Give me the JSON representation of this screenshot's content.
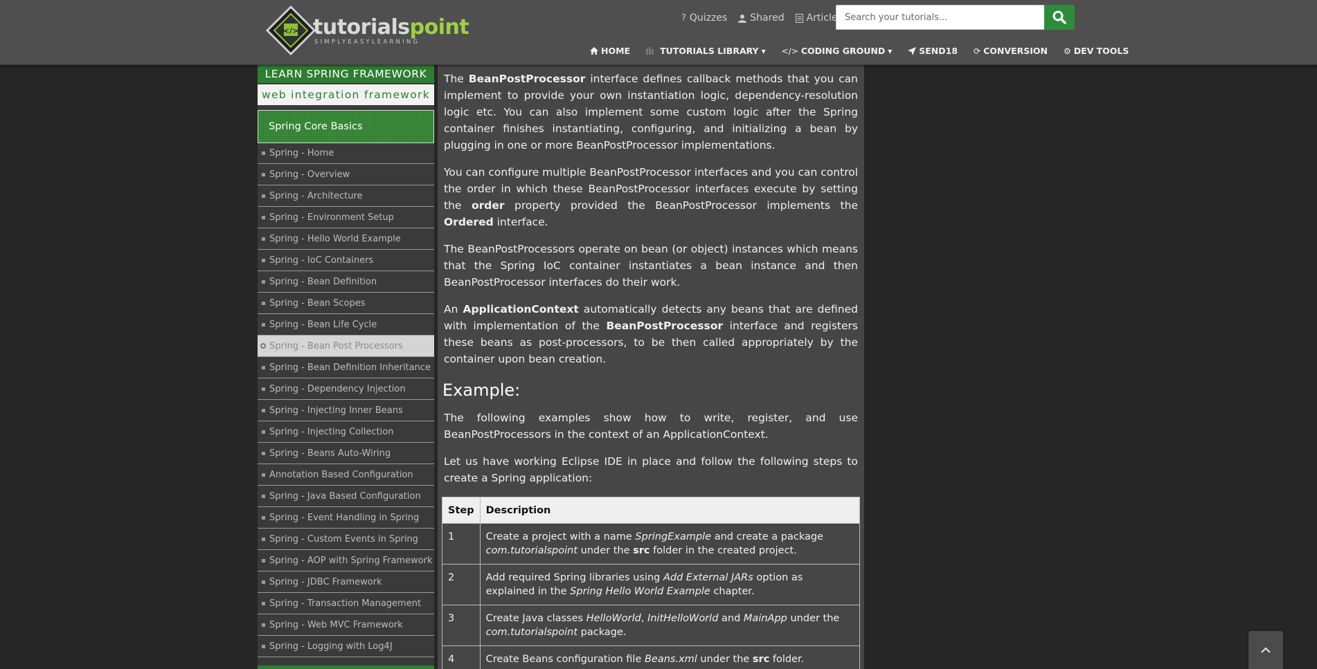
{
  "header": {
    "logo": {
      "brand_main": "tutorials",
      "brand_accent": "point",
      "tagline": "SIMPLYEASYLEARNING"
    },
    "top_links": [
      {
        "label": "Quizzes",
        "icon": "question-icon"
      },
      {
        "label": "Shared",
        "icon": "user-icon"
      },
      {
        "label": "Articles",
        "icon": "document-icon"
      }
    ],
    "search": {
      "placeholder": "Search your tutorials...",
      "icon": "search-icon"
    },
    "nav": [
      {
        "label": "HOME",
        "icon": "home-icon"
      },
      {
        "label": "TUTORIALS LIBRARY",
        "icon": "library-icon"
      },
      {
        "label": "CODING GROUND",
        "icon": "code-icon"
      },
      {
        "label": "SEND18",
        "icon": "send-icon"
      },
      {
        "label": "CONVERSION",
        "icon": "refresh-icon"
      },
      {
        "label": "DEV TOOLS",
        "icon": "gear-icon"
      }
    ]
  },
  "sidebar": {
    "banner": {
      "line1": "LEARN SPRING FRAMEWORK",
      "line2": "web integration framework"
    },
    "section_title": "Spring Core Basics",
    "items": [
      "Spring - Home",
      "Spring - Overview",
      "Spring - Architecture",
      "Spring - Environment Setup",
      "Spring - Hello World Example",
      "Spring - IoC Containers",
      "Spring - Bean Definition",
      "Spring - Bean Scopes",
      "Spring - Bean Life Cycle",
      "Spring - Bean Post Processors",
      "Spring - Bean Definition Inheritance",
      "Spring - Dependency Injection",
      "Spring - Injecting Inner Beans",
      "Spring - Injecting Collection",
      "Spring - Beans Auto-Wiring",
      "Annotation Based Configuration",
      "Spring - Java Based Configuration",
      "Spring - Event Handling in Spring",
      "Spring - Custom Events in Spring",
      "Spring - AOP with Spring Framework",
      "Spring - JDBC Framework",
      "Spring - Transaction Management",
      "Spring - Web MVC Framework",
      "Spring - Logging with Log4J"
    ],
    "active_item": "Spring - Bean Post Processors"
  },
  "content": {
    "p1": {
      "a": "The ",
      "b1": "BeanPostProcessor",
      "c": " interface defines callback methods that you can implement to provide your own instantiation logic, dependency-resolution logic etc. You can also implement some custom logic after the Spring container finishes instantiating, configuring, and initializing a bean by plugging in one or more BeanPostProcessor implementations."
    },
    "p2": {
      "a": "You can configure multiple BeanPostProcessor interfaces and you can control the order in which these BeanPostProcessor interfaces execute by setting the ",
      "b1": "order",
      "c": " property provided the BeanPostProcessor implements the ",
      "b2": "Ordered",
      "d": " interface."
    },
    "p3": "The BeanPostProcessors operate on bean (or object) instances which means that the Spring IoC container instantiates a bean instance and then BeanPostProcessor interfaces do their work.",
    "p4": {
      "a": "An ",
      "b1": "ApplicationContext",
      "c": " automatically detects any beans that are defined with implementation of the ",
      "b2": "BeanPostProcessor",
      "d": " interface and registers these beans as post-processors, to be then called appropriately by the container upon bean creation."
    },
    "example_heading": "Example:",
    "p5": "The following examples show how to write, register, and use BeanPostProcessors in the context of an ApplicationContext.",
    "p6": "Let us have working Eclipse IDE in place and follow the following steps to create a Spring application:",
    "table": {
      "headers": [
        "Step",
        "Description"
      ],
      "rows": [
        {
          "step": "1",
          "t1": "Create a project with a name ",
          "i1": "SpringExample",
          "t2": " and create a package ",
          "i2": "com.tutorialspoint",
          "t3": " under the ",
          "b1": "src",
          "t4": " folder in the created project."
        },
        {
          "step": "2",
          "t1": "Add required Spring libraries using ",
          "i1": "Add External JARs",
          "t2": " option as explained in the ",
          "i2": "Spring Hello World Example",
          "t3": " chapter."
        },
        {
          "step": "3",
          "t1": "Create Java classes ",
          "i1": "HelloWorld",
          "t2": ", ",
          "i2": "InitHelloWorld",
          "t3": " and ",
          "i3": "MainApp",
          "t4": " under the ",
          "i4": "com.tutorialspoint",
          "t5": " package."
        },
        {
          "step": "4",
          "t1": "Create Beans configuration file ",
          "i1": "Beans.xml",
          "t2": " under the ",
          "b1": "src",
          "t3": " folder."
        }
      ]
    }
  },
  "scroll_top": {
    "icon": "chevron-up-icon"
  }
}
